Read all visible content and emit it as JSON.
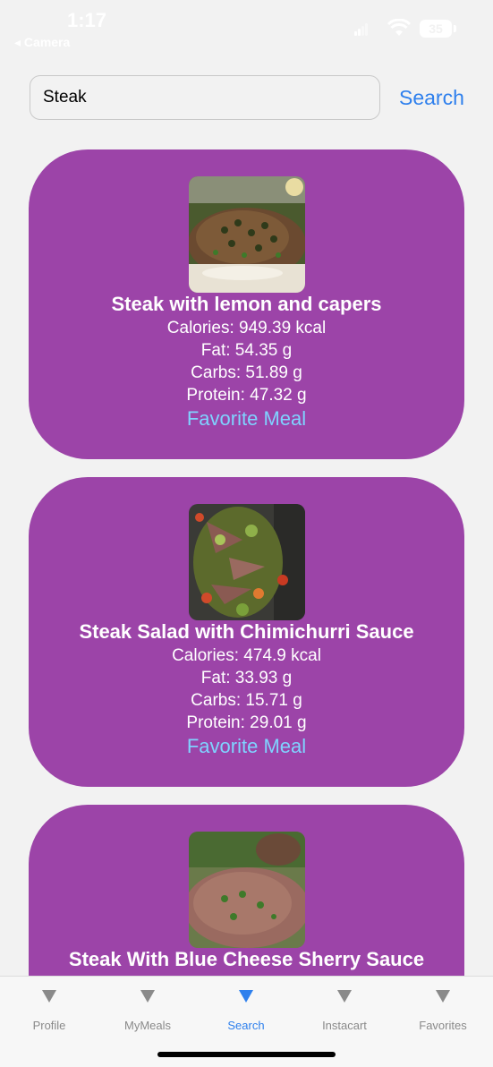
{
  "status_bar": {
    "time": "1:17",
    "back_app": "◂ Camera",
    "battery": "35"
  },
  "search": {
    "value": "Steak",
    "button_label": "Search"
  },
  "meals": [
    {
      "name": "Steak with lemon and capers",
      "calories": "Calories: 949.39 kcal",
      "fat": "Fat: 54.35 g",
      "carbs": "Carbs: 51.89 g",
      "protein": "Protein: 47.32 g",
      "favorite_label": "Favorite Meal"
    },
    {
      "name": "Steak Salad with Chimichurri Sauce",
      "calories": "Calories: 474.9 kcal",
      "fat": "Fat: 33.93 g",
      "carbs": "Carbs: 15.71 g",
      "protein": "Protein: 29.01 g",
      "favorite_label": "Favorite Meal"
    },
    {
      "name": "Steak With Blue Cheese Sherry Sauce"
    }
  ],
  "tabs": [
    {
      "label": "Profile",
      "icon": "triangle-down-icon",
      "active": false
    },
    {
      "label": "MyMeals",
      "icon": "triangle-down-icon",
      "active": false
    },
    {
      "label": "Search",
      "icon": "triangle-down-icon",
      "active": true
    },
    {
      "label": "Instacart",
      "icon": "triangle-down-icon",
      "active": false
    },
    {
      "label": "Favorites",
      "icon": "triangle-down-icon",
      "active": false
    }
  ],
  "colors": {
    "card_background": "#9c44a8",
    "accent_blue": "#2f80ed",
    "favorite_link": "#7fd3ff",
    "tab_inactive": "#8a8a8a"
  }
}
